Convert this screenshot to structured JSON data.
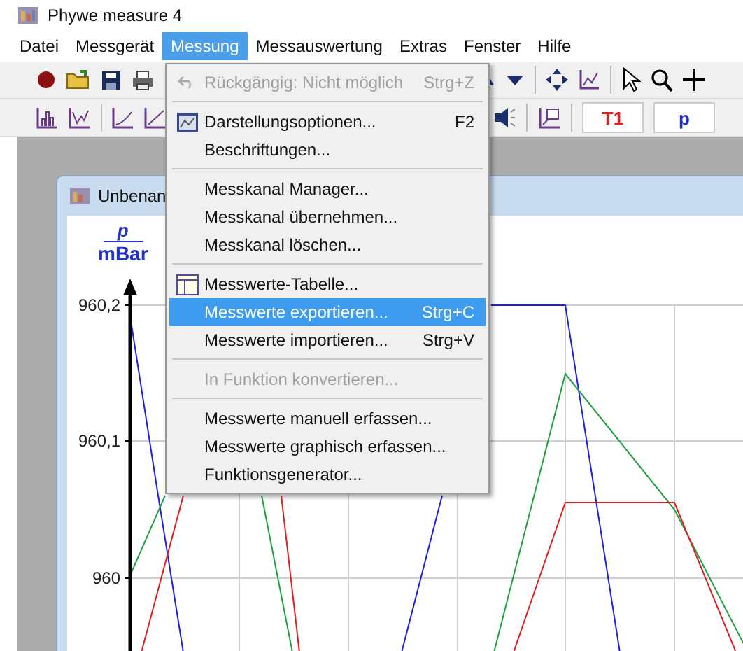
{
  "window": {
    "title": "Phywe measure 4"
  },
  "menubar": [
    {
      "label": "Datei",
      "selected": false
    },
    {
      "label": "Messgerät",
      "selected": false
    },
    {
      "label": "Messung",
      "selected": true
    },
    {
      "label": "Messauswertung",
      "selected": false
    },
    {
      "label": "Extras",
      "selected": false
    },
    {
      "label": "Fenster",
      "selected": false
    },
    {
      "label": "Hilfe",
      "selected": false
    }
  ],
  "toolbar2": {
    "channel_buttons": [
      {
        "label": "T1",
        "color": "#e02020"
      },
      {
        "label": "p",
        "color": "#1f2fd0"
      }
    ]
  },
  "menu": [
    {
      "kind": "command",
      "label": "Rückgängig: Nicht möglich",
      "shortcut": "Strg+Z",
      "disabled": true,
      "selected": false
    },
    {
      "kind": "separator"
    },
    {
      "kind": "command",
      "label": "Darstellungsoptionen...",
      "shortcut": "F2",
      "disabled": false,
      "selected": false
    },
    {
      "kind": "command",
      "label": "Beschriftungen...",
      "disabled": false,
      "selected": false
    },
    {
      "kind": "separator"
    },
    {
      "kind": "command",
      "label": "Messkanal Manager...",
      "disabled": false,
      "selected": false
    },
    {
      "kind": "command",
      "label": "Messkanal übernehmen...",
      "disabled": false,
      "selected": false
    },
    {
      "kind": "command",
      "label": "Messkanal löschen...",
      "disabled": false,
      "selected": false
    },
    {
      "kind": "separator"
    },
    {
      "kind": "command",
      "label": "Messwerte-Tabelle...",
      "disabled": false,
      "selected": false
    },
    {
      "kind": "command",
      "label": "Messwerte exportieren...",
      "shortcut": "Strg+C",
      "disabled": false,
      "selected": true
    },
    {
      "kind": "command",
      "label": "Messwerte importieren...",
      "shortcut": "Strg+V",
      "disabled": false,
      "selected": false
    },
    {
      "kind": "separator"
    },
    {
      "kind": "command",
      "label": "In Funktion konvertieren...",
      "disabled": true,
      "selected": false
    },
    {
      "kind": "separator"
    },
    {
      "kind": "command",
      "label": "Messwerte manuell erfassen...",
      "disabled": false,
      "selected": false
    },
    {
      "kind": "command",
      "label": "Messwerte graphisch erfassen...",
      "disabled": false,
      "selected": false
    },
    {
      "kind": "command",
      "label": "Funktionsgenerator...",
      "disabled": false,
      "selected": false
    }
  ],
  "document_window": {
    "title": "Unbenan",
    "y_axis": {
      "symbol": "p",
      "unit": "mBar",
      "ticks": [
        "960,2",
        "960,1",
        "960"
      ]
    }
  }
}
